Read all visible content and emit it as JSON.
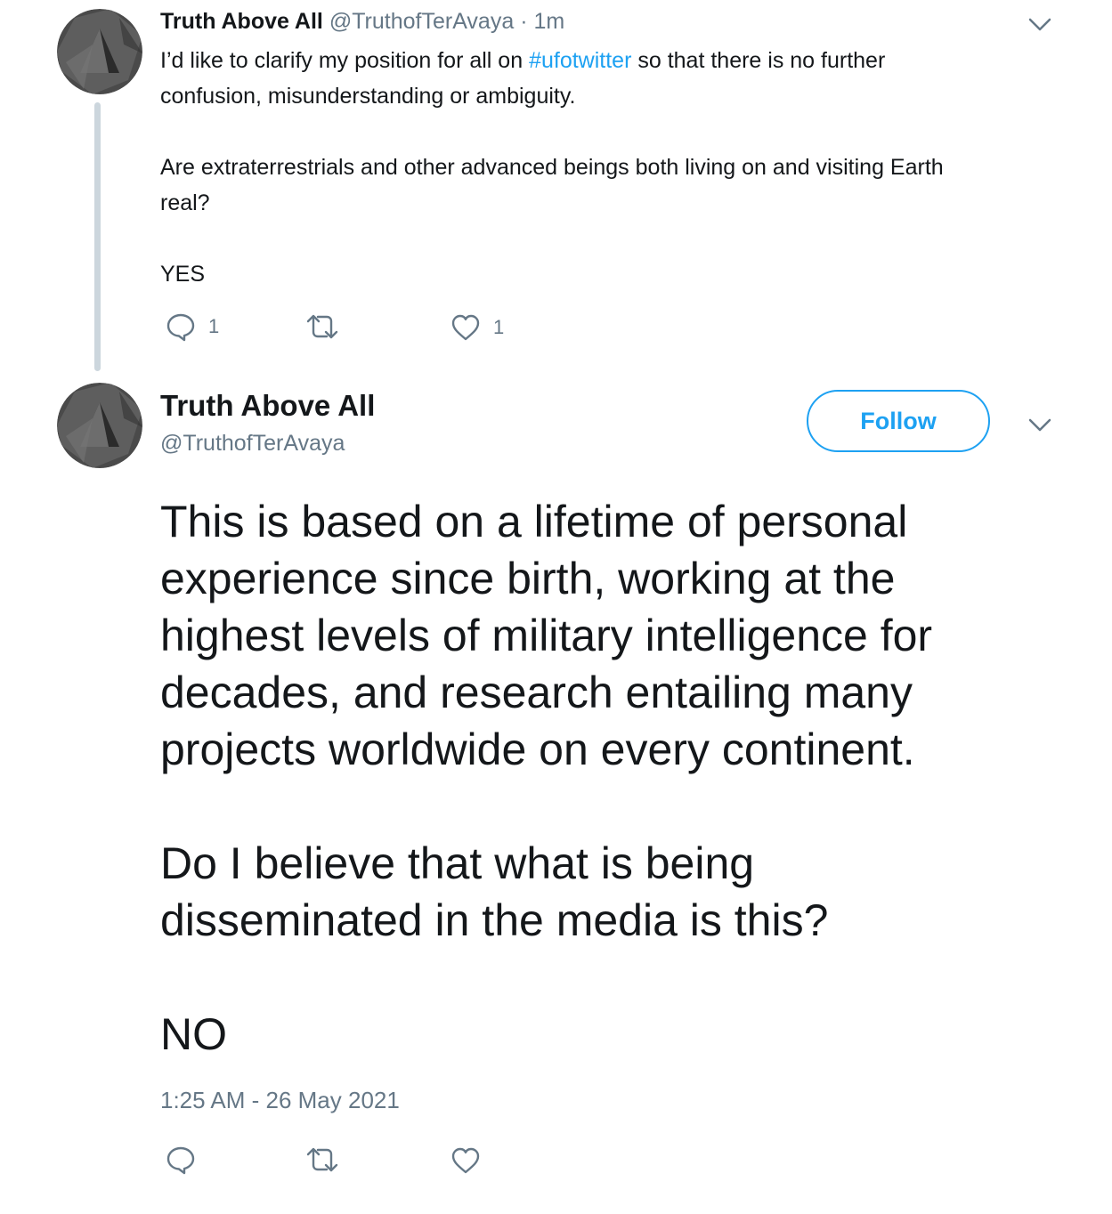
{
  "tweet1": {
    "name": "Truth Above All",
    "handle": "@TruthofTerAvaya",
    "sep": "·",
    "time": "1m",
    "text_line1_before": "I’d like to clarify my position for all on ",
    "hashtag": "#ufotwitter",
    "text_line1_after": " so that there is no further",
    "text_line2": "confusion, misunderstanding or ambiguity.",
    "text_line3": "Are extraterrestrials and other advanced beings both living on and visiting Earth",
    "text_line4": "real?",
    "text_line5": "YES",
    "reply_count": "1",
    "like_count": "1",
    "icons": [
      "reply-icon",
      "retweet-icon",
      "like-icon",
      "chevron-down-icon"
    ]
  },
  "tweet2": {
    "name": "Truth Above All",
    "handle": "@TruthofTerAvaya",
    "follow_label": "Follow",
    "lines": [
      "This is based on a lifetime of personal",
      "experience since birth, working at the",
      "highest levels of military intelligence for",
      "decades, and research entailing many",
      "projects worldwide on every continent.",
      "Do I believe that what is being",
      "disseminated in the media is this?",
      "NO"
    ],
    "timestamp": "1:25 AM - 26 May 2021",
    "icons": [
      "reply-icon",
      "retweet-icon",
      "like-icon",
      "chevron-down-icon"
    ]
  },
  "colors": {
    "accent": "#1da1f2",
    "muted": "#657786",
    "text": "#14171a",
    "thread": "#ccd6dd"
  }
}
